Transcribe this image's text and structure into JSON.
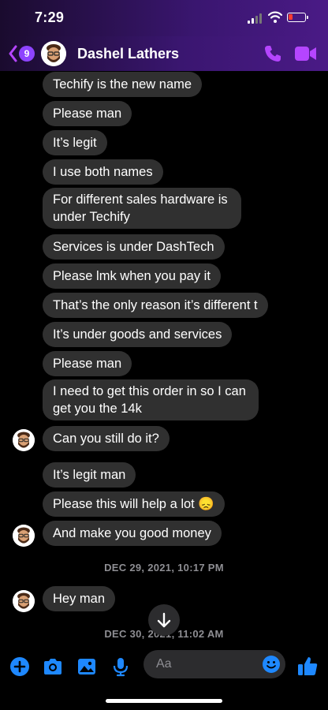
{
  "status_bar": {
    "time": "7:29"
  },
  "header": {
    "back_count": "9",
    "contact_name": "Dashel Lathers"
  },
  "messages": [
    {
      "text": "Techify is the new name"
    },
    {
      "text": "Please man"
    },
    {
      "text": "It’s legit"
    },
    {
      "text": "I use both names"
    },
    {
      "text": "For different sales hardware is under Techify"
    },
    {
      "text": "Services is under DashTech"
    },
    {
      "text": "Please lmk when you pay it"
    },
    {
      "text": "That’s the only reason it’s different t"
    },
    {
      "text": "It’s under goods and services"
    },
    {
      "text": "Please man"
    },
    {
      "text": "I need to get this order in so I can get you the 14k"
    },
    {
      "text": "Can you still do it?"
    },
    {
      "text": "It’s legit man"
    },
    {
      "text": "Please this will help a lot 😞"
    },
    {
      "text": "And make you good money"
    },
    {
      "text": "Hey man"
    }
  ],
  "timestamps": {
    "first": "DEC 29, 2021, 10:17 PM",
    "second": "DEC 30, 2021, 11:02 AM"
  },
  "composer": {
    "placeholder": "Aa"
  },
  "colors": {
    "accent": "#b545ff",
    "composer_icon": "#1e88ff",
    "bubble": "#303030",
    "badge": "#8e44ff"
  },
  "icons": {
    "back": "chevron-left-icon",
    "call": "phone-icon",
    "video": "video-camera-icon",
    "add": "plus-circle-icon",
    "camera": "camera-icon",
    "gallery": "image-icon",
    "mic": "microphone-icon",
    "emoji": "smiley-icon",
    "like": "thumbs-up-icon",
    "scroll": "arrow-down-icon"
  }
}
